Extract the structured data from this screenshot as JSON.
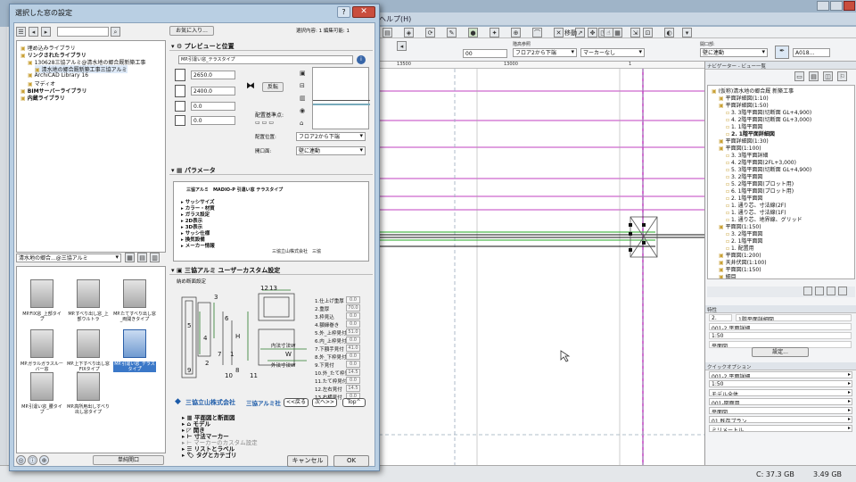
{
  "app": {
    "title_fragment": "ヘルプ(H)",
    "menu_move": "移動",
    "layer_label": "階高参照",
    "layer_value": "フロア2から下端",
    "marker_value": "マーカーなし",
    "opening_label": "開口部:",
    "opening_value": "壁に連動",
    "field_00": "00",
    "field_a018": "A018...",
    "ruler_1": "13500",
    "ruler_2": "13000",
    "ruler_3": "1",
    "status_c": "C: 37.3 GB",
    "status_mem": "3.49 GB"
  },
  "navigator": {
    "header": "ナビゲーター - ビュー一覧",
    "items": [
      "(仮称)清水地の郷合厩 新築工事",
      "平面詳細図(1:10)",
      "平面詳細図(1:50)",
      "3. 3階平面図(切断面 GL+4,900)",
      "4. 2階平面図(切断面 GL+3,000)",
      "1. 1階平面図",
      "2. 1階平面詳細図",
      "平面詳細図(1:30)",
      "平面図(1:100)",
      "3. 3階平面詳細",
      "4. 2階平面図(2FL+3,000)",
      "5. 3階平面図(切断面 GL+4,900)",
      "3. 2階平面図",
      "5. 2階平面図(プロット用)",
      "6. 1階平面図(プロット用)",
      "2. 1階平面図",
      "1. 通り芯、寸法線(2F)",
      "1. 通り芯、寸法線(1F)",
      "1. 通り芯、地界線、グリッド",
      "平面図(1:150)",
      "3. 2階平面図",
      "2. 1階平面図",
      "1. 配置用",
      "平面図(1:200)",
      "天井伏図(1:100)",
      "平面図(1:150)",
      "細目"
    ],
    "props_header": "特性",
    "prop_num": "2.",
    "prop_name": "1階平面詳細図",
    "prop_ref": "001-2.平面詳細",
    "prop_scale": "1:50",
    "prop_type": "平面図",
    "settings_btn": "設定...",
    "quick_header": "クイックオプション",
    "quick": [
      "001-2.平面詳細",
      "1:50",
      "モデル全体",
      "001-図面用",
      "平面図",
      "01 既存プラン",
      "ミリメートル"
    ]
  },
  "dialog": {
    "title": "選択した窓の設定",
    "help": "?",
    "close": "✕",
    "favorites": "お気に入り...",
    "selection_info": "選択内容: 1 編集可能: 1",
    "lib_search_placeholder": "",
    "lib_tree": [
      "埋め込みライブラリ",
      "リンクされたライブラリ",
      "130628三協アルミ@清水地の郷合厩新築工事",
      "清水地の郷合厩新築工事三協アルミ",
      "ArchiCAD Library 16",
      "マディオ",
      "BIMサーバーライブラリ",
      "内蔵ライブラリ"
    ],
    "lib_folder": "清水地の郷合...@三協アルミ",
    "thumbs": [
      "MP.FIX窓_上部タイプ",
      "MP.すべり出し窓_上部ウルトラ",
      "MP.たてすべり出し窓_両開きタイプ",
      "MP.ガラルガラスルーバー窓",
      "MP.上下すべり出し窓_FIXタイプ",
      "MP.引違い窓_テラスタイプ",
      "MP.引違い窓_腰タイプ",
      "MP.高所用出しすべり出し窓タイプ"
    ],
    "manage_btn": "単純開口",
    "preview_header": "プレビューと位置",
    "object_name": "MP.引違い窓_テラスタイプ",
    "width": "2650.0",
    "height": "2400.0",
    "z1": "0.0",
    "z2": "0.0",
    "reverse_btn": "反転",
    "anchor_label": "配置基準点:",
    "floor_label": "配置位置:",
    "floor_value": "フロア2から下端",
    "opening_label": "開口面:",
    "opening_value": "壁に連動",
    "params_header": "パラメータ",
    "params_title": "三協アルミ　MADIO-P 引違い窓 テラスタイプ",
    "params": [
      "サッシサイズ",
      "カラー・材質",
      "ガラス設定",
      "2D表示",
      "3D表示",
      "サッシ仕様",
      "換気設備",
      "メーカー情報"
    ],
    "maker_value": "三協立山株式会社　三協",
    "custom_header": "三協アルミ ユーザーカスタム設定",
    "section_label": "納め断面設定",
    "specs": [
      "1.仕上げ重厚",
      "2.重厚",
      "3.枠見込",
      "4.額縁巻き",
      "5.外_上枠見付",
      "6.内_上枠見付",
      "7.下額手見付",
      "8.外_下枠見付",
      "9.下見付",
      "10.外_たて枠見付",
      "11.たて枠見付",
      "12.左右見付",
      "13.右横見付"
    ],
    "spec_vals": [
      "0.0",
      "70.0",
      "0.0",
      "0.0",
      "51.0",
      "0.0",
      "41.0",
      "0.0",
      "0.0",
      "14.5",
      "0.0",
      "14.5",
      "0.0"
    ],
    "logo_text": "三協立山株式会社",
    "logo_sub": "三協アルミ社",
    "back_btn": "<<戻る",
    "next_btn": "次へ>>",
    "top_btn": "Top^",
    "bottom_sections": [
      "平面図と断面図",
      "モデル",
      "開き",
      "寸法マーカー",
      "マーカーのカスタム設定",
      "リストとラベル",
      "タグとカテゴリ"
    ],
    "cancel": "キャンセル",
    "ok": "OK",
    "diagram_labels": [
      "12",
      "13",
      "3",
      "5",
      "6",
      "4",
      "H",
      "7",
      "1",
      "2",
      "W",
      "8",
      "9",
      "10",
      "11",
      "内法寸法W",
      "外法寸法W"
    ]
  }
}
